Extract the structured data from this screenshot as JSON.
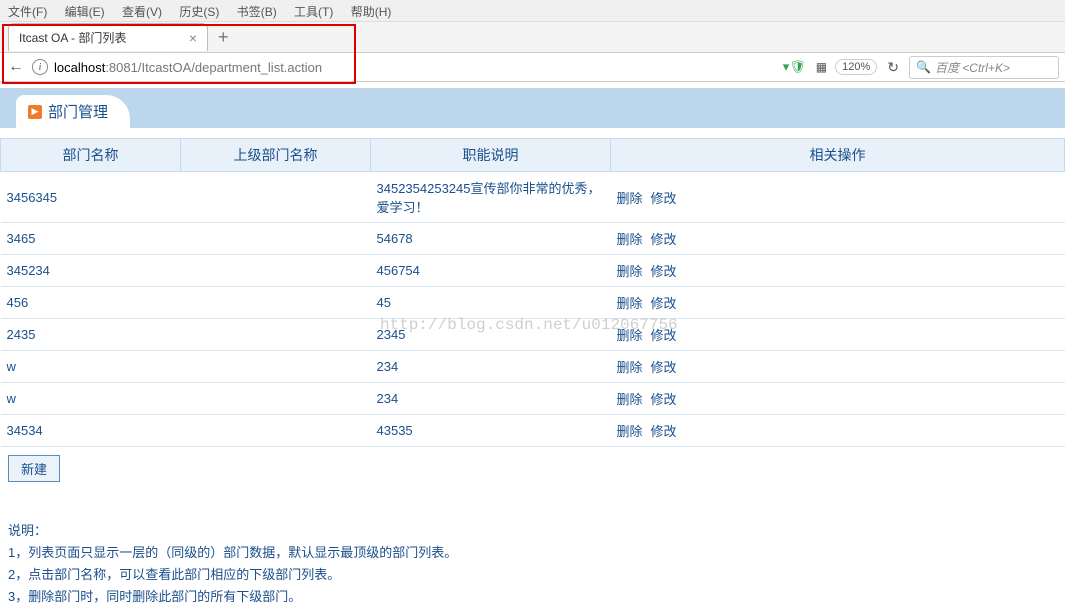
{
  "menu": {
    "file": "文件(F)",
    "edit": "编辑(E)",
    "view": "查看(V)",
    "history": "历史(S)",
    "bookmarks": "书签(B)",
    "tools": "工具(T)",
    "help": "帮助(H)"
  },
  "tab": {
    "title": "Itcast OA - 部门列表"
  },
  "url": {
    "host": "localhost",
    "port": ":8081",
    "path": "/ItcastOA/department_list.action"
  },
  "zoom": "120%",
  "search": {
    "placeholder": "百度 <Ctrl+K>"
  },
  "page_title": "部门管理",
  "columns": {
    "name": "部门名称",
    "parent": "上级部门名称",
    "desc": "职能说明",
    "ops": "相关操作"
  },
  "op": {
    "del": "删除",
    "edit": "修改"
  },
  "rows": [
    {
      "name": "3456345",
      "parent": "",
      "desc": "3452354253245宣传部你非常的优秀，爱学习！"
    },
    {
      "name": "3465",
      "parent": "",
      "desc": "54678"
    },
    {
      "name": "345234",
      "parent": "",
      "desc": "456754"
    },
    {
      "name": "456",
      "parent": "",
      "desc": "45"
    },
    {
      "name": "2435",
      "parent": "",
      "desc": "2345"
    },
    {
      "name": "w",
      "parent": "",
      "desc": "234"
    },
    {
      "name": "w",
      "parent": "",
      "desc": "234"
    },
    {
      "name": "34534",
      "parent": "",
      "desc": "43535"
    }
  ],
  "new_btn": "新建",
  "notes": {
    "title": "说明：",
    "l1": "1，列表页面只显示一层的（同级的）部门数据，默认显示最顶级的部门列表。",
    "l2": "2，点击部门名称，可以查看此部门相应的下级部门列表。",
    "l3": "3，删除部门时，同时删除此部门的所有下级部门。"
  },
  "watermark": "http://blog.csdn.net/u012067756"
}
